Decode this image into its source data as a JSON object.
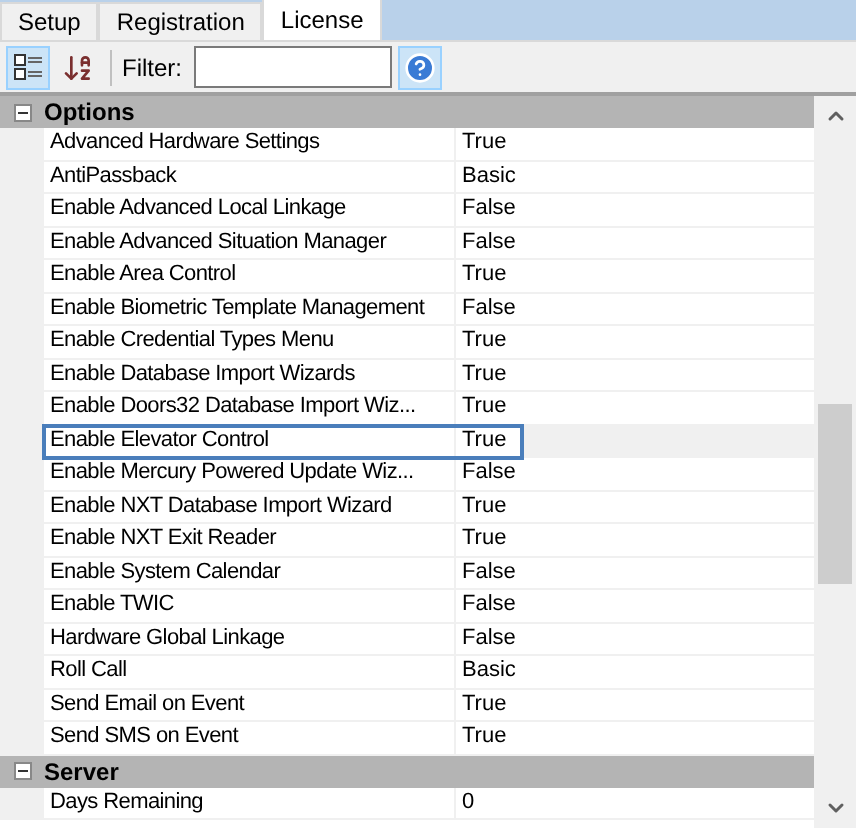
{
  "tabs": [
    {
      "label": "Setup",
      "selected": false
    },
    {
      "label": "Registration",
      "selected": false
    },
    {
      "label": "License",
      "selected": true
    }
  ],
  "toolbar": {
    "categorized_selected": true,
    "filter_label": "Filter:"
  },
  "categories": [
    {
      "name": "Options",
      "expanded": true,
      "properties": [
        {
          "name": "Advanced Hardware Settings",
          "value": "True",
          "selected": false
        },
        {
          "name": "AntiPassback",
          "value": "Basic",
          "selected": false
        },
        {
          "name": "Enable Advanced Local Linkage",
          "value": "False",
          "selected": false
        },
        {
          "name": "Enable Advanced Situation Manager",
          "value": "False",
          "selected": false
        },
        {
          "name": "Enable Area Control",
          "value": "True",
          "selected": false
        },
        {
          "name": "Enable Biometric Template Management",
          "value": "False",
          "selected": false
        },
        {
          "name": "Enable Credential Types Menu",
          "value": "True",
          "selected": false
        },
        {
          "name": "Enable Database Import Wizards",
          "value": "True",
          "selected": false
        },
        {
          "name": "Enable Doors32 Database Import Wiz...",
          "value": "True",
          "selected": false
        },
        {
          "name": "Enable Elevator Control",
          "value": "True",
          "selected": true
        },
        {
          "name": "Enable Mercury Powered Update Wiz...",
          "value": "False",
          "selected": false
        },
        {
          "name": "Enable NXT Database Import Wizard",
          "value": "True",
          "selected": false
        },
        {
          "name": "Enable NXT Exit Reader",
          "value": "True",
          "selected": false
        },
        {
          "name": "Enable System Calendar",
          "value": "False",
          "selected": false
        },
        {
          "name": "Enable TWIC",
          "value": "False",
          "selected": false
        },
        {
          "name": "Hardware Global Linkage",
          "value": "False",
          "selected": false
        },
        {
          "name": "Roll Call",
          "value": "Basic",
          "selected": false
        },
        {
          "name": "Send Email on Event",
          "value": "True",
          "selected": false
        },
        {
          "name": "Send SMS on Event",
          "value": "True",
          "selected": false
        }
      ]
    },
    {
      "name": "Server",
      "expanded": true,
      "properties": [
        {
          "name": "Days Remaining",
          "value": "0",
          "selected": false
        }
      ]
    }
  ]
}
